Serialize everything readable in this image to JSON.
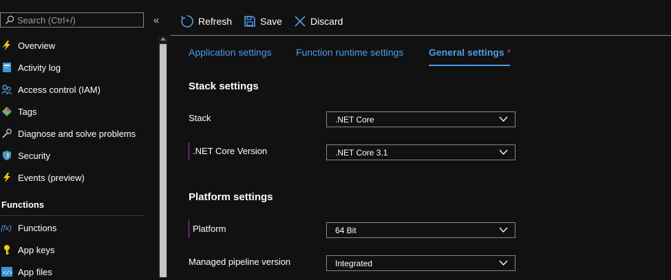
{
  "sidebar": {
    "search_placeholder": "Search (Ctrl+/)",
    "collapse_glyph": "«",
    "items": [
      {
        "label": "Overview",
        "icon": "lightning-icon"
      },
      {
        "label": "Activity log",
        "icon": "activity-log-icon"
      },
      {
        "label": "Access control (IAM)",
        "icon": "people-icon"
      },
      {
        "label": "Tags",
        "icon": "tag-icon"
      },
      {
        "label": "Diagnose and solve problems",
        "icon": "wrench-icon"
      },
      {
        "label": "Security",
        "icon": "shield-icon"
      },
      {
        "label": "Events (preview)",
        "icon": "lightning-icon"
      }
    ],
    "section_functions": "Functions",
    "function_items": [
      {
        "label": "Functions",
        "icon": "function-icon"
      },
      {
        "label": "App keys",
        "icon": "key-icon"
      },
      {
        "label": "App files",
        "icon": "code-file-icon"
      }
    ]
  },
  "toolbar": {
    "refresh": "Refresh",
    "save": "Save",
    "discard": "Discard"
  },
  "tabs": [
    {
      "label": "Application settings"
    },
    {
      "label": "Function runtime settings"
    },
    {
      "label": "General settings",
      "modified_marker": "*",
      "active": true
    }
  ],
  "stack_settings": {
    "title": "Stack settings",
    "stack_label": "Stack",
    "stack_value": ".NET Core",
    "version_label": ".NET Core Version",
    "version_value": ".NET Core 3.1"
  },
  "platform_settings": {
    "title": "Platform settings",
    "platform_label": "Platform",
    "platform_value": "64 Bit",
    "pipeline_label": "Managed pipeline version",
    "pipeline_value": "Integrated"
  },
  "colors": {
    "background": "#111111",
    "accent": "#4f9ce6",
    "required_marker": "#c239b3",
    "border": "#8a8886"
  }
}
